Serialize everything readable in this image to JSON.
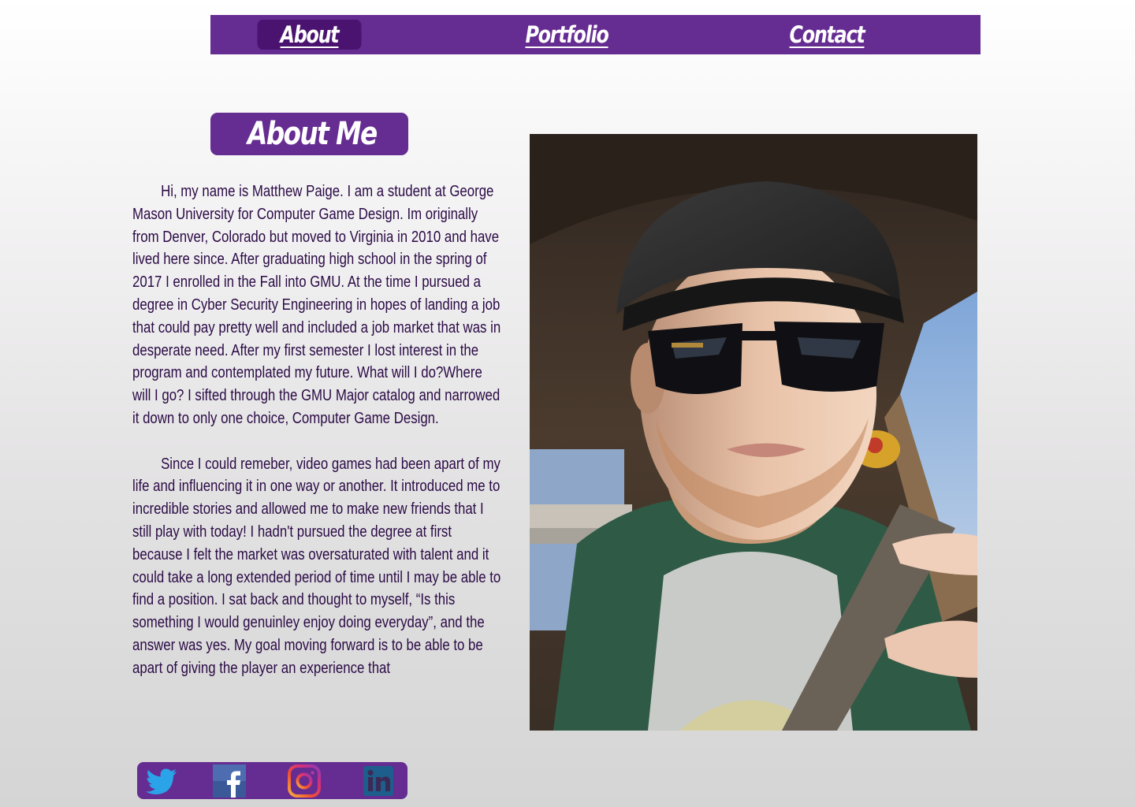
{
  "nav": {
    "items": [
      {
        "label": "About",
        "active": true
      },
      {
        "label": "Portfolio",
        "active": false
      },
      {
        "label": "Contact",
        "active": false
      }
    ],
    "bar_color": "#652c91",
    "active_color": "#4a1370"
  },
  "heading": {
    "title": "About Me"
  },
  "bio": {
    "paragraphs": [
      "Hi, my name is Matthew Paige. I am a student at George Mason University for Computer Game Design. Im originally from Denver, Colorado but moved to Virginia in 2010 and have lived here since. After graduating high school in the spring of 2017 I enrolled in the Fall into GMU. At the time I pursued a degree in Cyber Security Engineering in hopes of landing a job that could pay pretty well and included a job market that was in desperate need. After my first semester I lost interest in the program and contemplated my future. What will I do?Where will I go? I sifted through the GMU Major catalog and narrowed it down to only one choice, Computer Game Design.",
      "Since I could remeber, video games had been apart of my life and influencing it in one way or another. It introduced me to incredible stories and allowed me to make new friends that I still play with today! I hadn't pursued the degree at first because I felt the market was oversaturated with talent and it could take a long extended period of time until  I may be able to find a position. I sat back and thought to myself, “Is this something I would genuinley enjoy doing everyday”, and the answer was yes. My goal moving forward is to be able to be apart of giving the player an experience that"
    ],
    "text_color": "#2a0a45"
  },
  "photo": {
    "subject": "selfie-in-car-wearing-cap-and-sunglasses"
  },
  "social": {
    "icons": [
      "twitter-icon",
      "facebook-icon",
      "instagram-icon",
      "linkedin-icon"
    ],
    "bar_color": "#652c91"
  }
}
